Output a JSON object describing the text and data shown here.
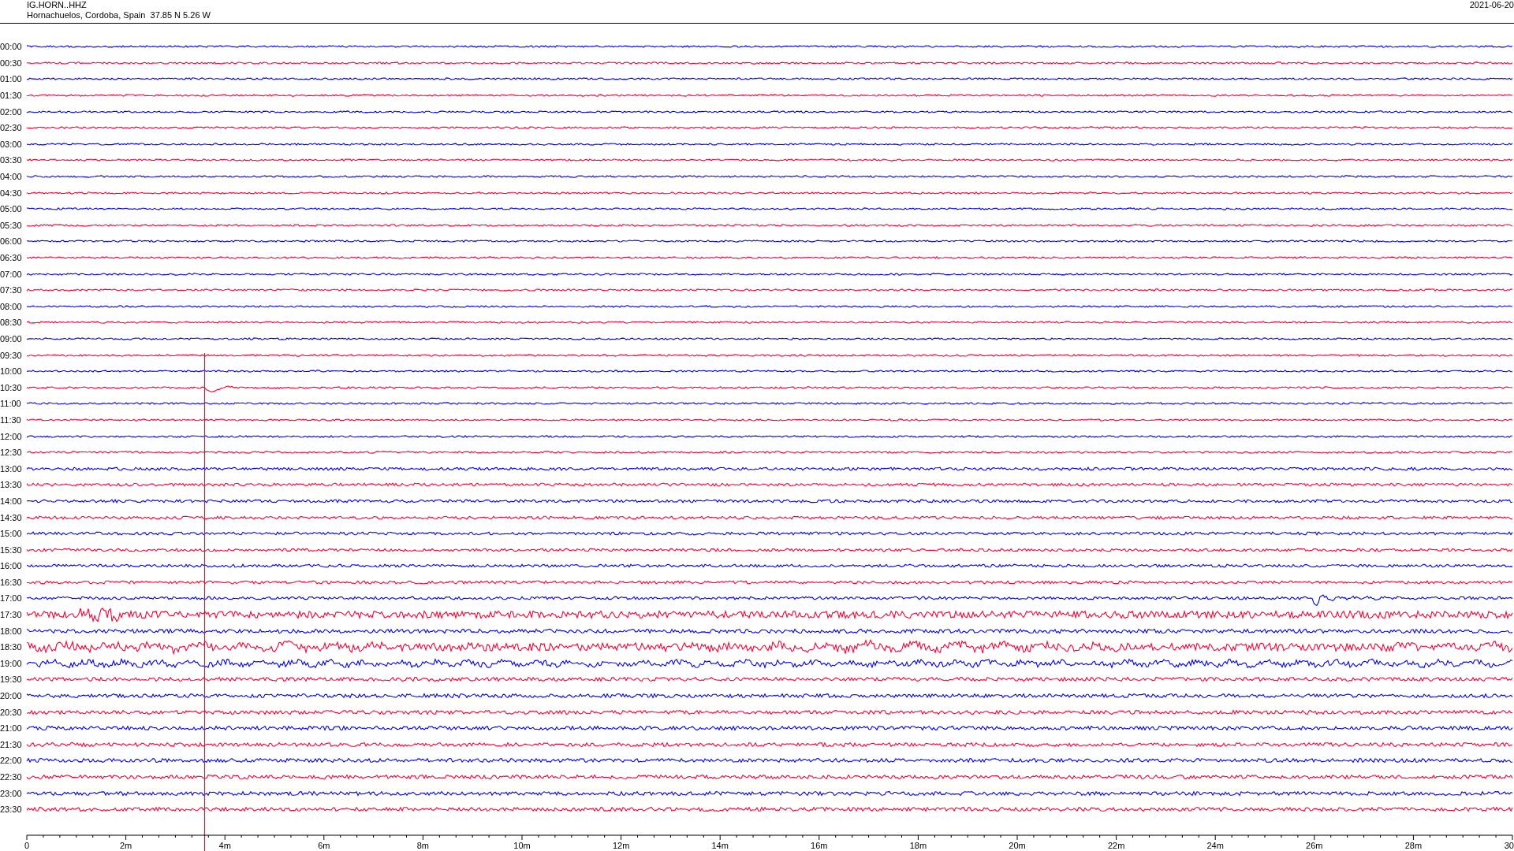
{
  "header": {
    "station": "IG.HORN..HHZ",
    "location": "Hornachuelos, Cordoba, Spain  37.85 N 5.26 W",
    "date": "2021-06-20"
  },
  "rows": [
    {
      "time": "00:00",
      "color": "#0000ff"
    },
    {
      "time": "00:30",
      "color": "#ff0033"
    },
    {
      "time": "01:00",
      "color": "#0000ff"
    },
    {
      "time": "01:30",
      "color": "#ff0033"
    },
    {
      "time": "02:00",
      "color": "#0000ff"
    },
    {
      "time": "02:30",
      "color": "#ff0033"
    },
    {
      "time": "03:00",
      "color": "#0000ff"
    },
    {
      "time": "03:30",
      "color": "#ff0033"
    },
    {
      "time": "04:00",
      "color": "#0000ff"
    },
    {
      "time": "04:30",
      "color": "#ff0033"
    },
    {
      "time": "05:00",
      "color": "#0000ff"
    },
    {
      "time": "05:30",
      "color": "#ff0033"
    },
    {
      "time": "06:00",
      "color": "#0000ff"
    },
    {
      "time": "06:30",
      "color": "#ff0033"
    },
    {
      "time": "07:00",
      "color": "#0000ff"
    },
    {
      "time": "07:30",
      "color": "#ff0033"
    },
    {
      "time": "08:00",
      "color": "#0000ff"
    },
    {
      "time": "08:30",
      "color": "#ff0033"
    },
    {
      "time": "09:00",
      "color": "#0000ff"
    },
    {
      "time": "09:30",
      "color": "#ff0033"
    },
    {
      "time": "10:00",
      "color": "#0000ff"
    },
    {
      "time": "10:30",
      "color": "#ff0033"
    },
    {
      "time": "11:00",
      "color": "#0000ff"
    },
    {
      "time": "11:30",
      "color": "#ff0033"
    },
    {
      "time": "12:00",
      "color": "#0000ff"
    },
    {
      "time": "12:30",
      "color": "#ff0033"
    },
    {
      "time": "13:00",
      "color": "#0000ff"
    },
    {
      "time": "13:30",
      "color": "#ff0033"
    },
    {
      "time": "14:00",
      "color": "#0000ff"
    },
    {
      "time": "14:30",
      "color": "#ff0033"
    },
    {
      "time": "15:00",
      "color": "#0000ff"
    },
    {
      "time": "15:30",
      "color": "#ff0033"
    },
    {
      "time": "16:00",
      "color": "#0000ff"
    },
    {
      "time": "16:30",
      "color": "#ff0033"
    },
    {
      "time": "17:00",
      "color": "#0000ff"
    },
    {
      "time": "17:30",
      "color": "#ff0033"
    },
    {
      "time": "18:00",
      "color": "#0000ff"
    },
    {
      "time": "18:30",
      "color": "#ff0033"
    },
    {
      "time": "19:00",
      "color": "#0000ff"
    },
    {
      "time": "19:30",
      "color": "#ff0033"
    },
    {
      "time": "20:00",
      "color": "#0000ff"
    },
    {
      "time": "20:30",
      "color": "#ff0033"
    },
    {
      "time": "21:00",
      "color": "#0000ff"
    },
    {
      "time": "21:30",
      "color": "#ff0033"
    },
    {
      "time": "22:00",
      "color": "#0000ff"
    },
    {
      "time": "22:30",
      "color": "#ff0033"
    },
    {
      "time": "23:00",
      "color": "#0000ff"
    },
    {
      "time": "23:30",
      "color": "#ff0033"
    }
  ],
  "axis": {
    "tick_labels": [
      "0",
      "2m",
      "4m",
      "6m",
      "8m",
      "10m",
      "12m",
      "14m",
      "16m",
      "18m",
      "20m",
      "22m",
      "24m",
      "26m",
      "28m",
      "30"
    ]
  }
}
